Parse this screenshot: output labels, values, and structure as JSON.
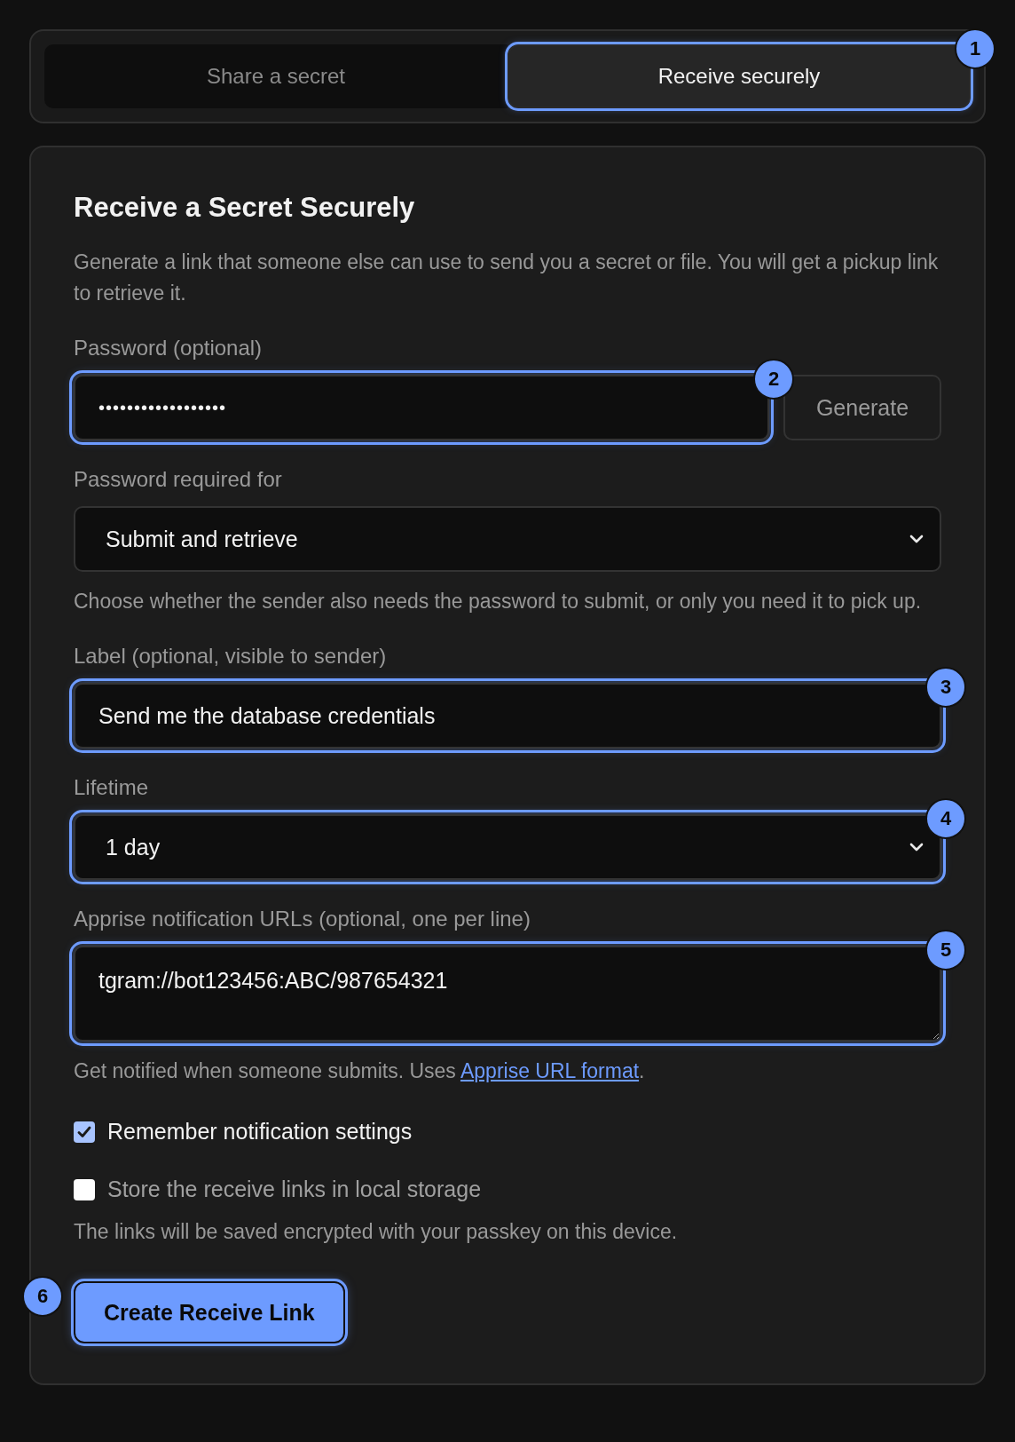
{
  "tabs": [
    {
      "label": "Share a secret",
      "selected": false,
      "highlighted": false
    },
    {
      "label": "Receive securely",
      "selected": true,
      "highlighted": true,
      "badge": "1"
    }
  ],
  "card": {
    "title": "Receive a Secret Securely",
    "description": "Generate a link that someone else can use to send you a secret or file. You will get a pickup link to retrieve it.",
    "fields": [
      {
        "kind": "password",
        "label": "Password (optional)",
        "value": "••••••••••••••••••",
        "highlighted": true,
        "badge": "2",
        "button": "Generate"
      },
      {
        "kind": "select",
        "label": "Password required for",
        "value": "Submit and retrieve",
        "highlighted": false,
        "help": "Choose whether the sender also needs the password to submit, or only you need it to pick up."
      },
      {
        "kind": "text",
        "label": "Label (optional, visible to sender)",
        "value": "Send me the database credentials",
        "highlighted": true,
        "badge": "3"
      },
      {
        "kind": "select",
        "label": "Lifetime",
        "value": "1 day",
        "highlighted": true,
        "badge": "4"
      },
      {
        "kind": "textarea",
        "label": "Apprise notification URLs (optional, one per line)",
        "value": "tgram://bot123456:ABC/987654321",
        "highlighted": true,
        "badge": "5",
        "help": "Get notified when someone submits. Uses ",
        "help_link": "Apprise URL format",
        "help_after": "."
      }
    ],
    "checkboxes": [
      {
        "label": "Remember notification settings",
        "checked": true
      },
      {
        "label": "Store the receive links in local storage",
        "checked": false,
        "help": "The links will be saved encrypted with your passkey on this device."
      }
    ],
    "submit": {
      "label": "Create Receive Link",
      "highlighted": true,
      "badge": "6"
    }
  }
}
